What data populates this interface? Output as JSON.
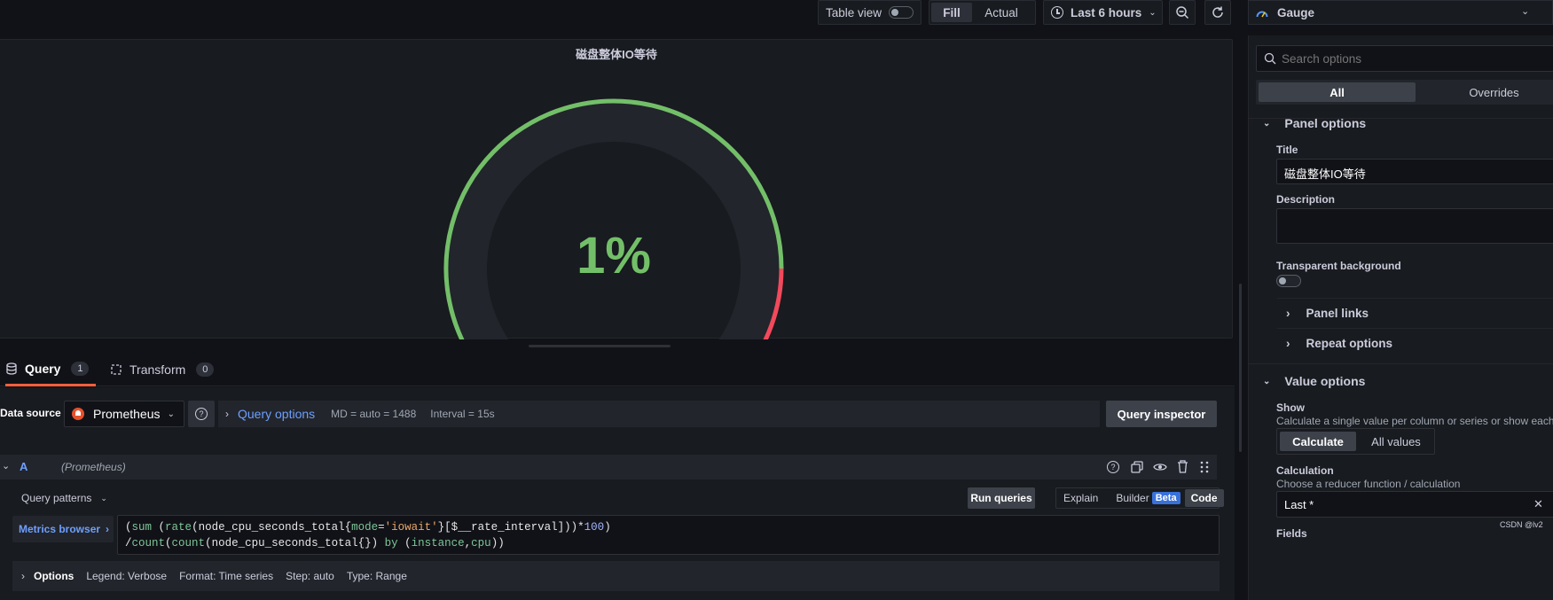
{
  "toolbar": {
    "table_view_label": "Table view",
    "fill_label": "Fill",
    "actual_label": "Actual",
    "time_range_label": "Last 6 hours"
  },
  "panel": {
    "title": "磁盘整体IO等待",
    "value_text": "1%",
    "value_percent": 1,
    "colors": {
      "green": "#73bf69",
      "red": "#f2495c",
      "track": "#22252b"
    }
  },
  "query_tabs": [
    {
      "label": "Query",
      "count": "1"
    },
    {
      "label": "Transform",
      "count": "0"
    }
  ],
  "datasource": {
    "label": "Data source",
    "name": "Prometheus",
    "query_options_label": "Query options",
    "md_text": "MD = auto = 1488",
    "interval_text": "Interval = 15s",
    "inspector_label": "Query inspector"
  },
  "query": {
    "ref_id": "A",
    "ds_name": "(Prometheus)",
    "patterns_label": "Query patterns",
    "run_label": "Run queries",
    "explain_label": "Explain",
    "builder_label": "Builder",
    "beta_label": "Beta",
    "code_label": "Code",
    "metrics_browser_label": "Metrics browser",
    "expr_line1": "(sum  (rate(node_cpu_seconds_total{mode='iowait'}[$__rate_interval]))*100)",
    "expr_line2": "/count(count(node_cpu_seconds_total{}) by (instance,cpu))",
    "options_label": "Options",
    "options_legend": "Legend: Verbose",
    "options_format": "Format: Time series",
    "options_step": "Step: auto",
    "options_type": "Type: Range"
  },
  "options_pane": {
    "viz_name": "Gauge",
    "search_placeholder": "Search options",
    "tab_all": "All",
    "tab_overrides": "Overrides",
    "panel_options_label": "Panel options",
    "title_label": "Title",
    "title_value": "磁盘整体IO等待",
    "description_label": "Description",
    "transparent_label": "Transparent background",
    "panel_links_label": "Panel links",
    "repeat_options_label": "Repeat options",
    "value_options_label": "Value options",
    "show_label": "Show",
    "show_desc": "Calculate a single value per column or series or show each ro",
    "calculate_label": "Calculate",
    "all_values_label": "All values",
    "calculation_label": "Calculation",
    "calculation_desc": "Choose a reducer function / calculation",
    "calculation_value": "Last *",
    "fields_label": "Fields",
    "watermark": "CSDN @lv2"
  }
}
